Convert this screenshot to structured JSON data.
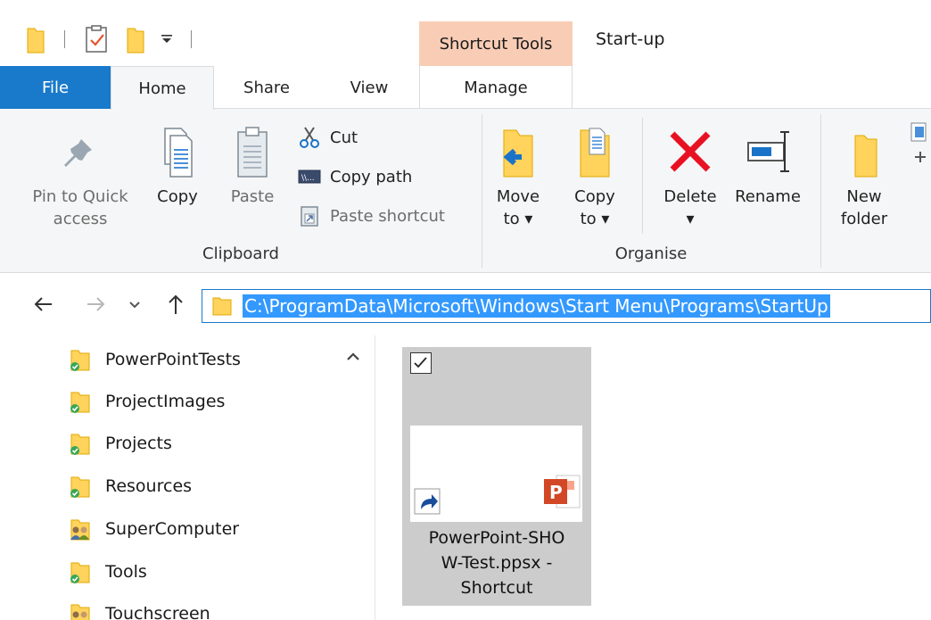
{
  "window": {
    "title": "Start-up",
    "contextual_group": "Shortcut Tools"
  },
  "tabs": {
    "file": "File",
    "home": "Home",
    "share": "Share",
    "view": "View",
    "manage": "Manage"
  },
  "ribbon": {
    "clipboard": {
      "group_label": "Clipboard",
      "pin_line1": "Pin to Quick",
      "pin_line2": "access",
      "copy": "Copy",
      "paste": "Paste",
      "cut": "Cut",
      "copy_path": "Copy path",
      "paste_shortcut": "Paste shortcut"
    },
    "organise": {
      "group_label": "Organise",
      "move_line1": "Move",
      "move_line2": "to ▾",
      "copy_line1": "Copy",
      "copy_line2": "to ▾",
      "delete_line1": "Delete",
      "delete_line2": "▾",
      "rename": "Rename"
    },
    "new": {
      "new_folder_line1": "New",
      "new_folder_line2": "folder"
    }
  },
  "address": {
    "path": "C:\\ProgramData\\Microsoft\\Windows\\Start Menu\\Programs\\StartUp"
  },
  "nav_tree": [
    {
      "label": "PowerPointTests",
      "icon": "folder-synced-icon"
    },
    {
      "label": "ProjectImages",
      "icon": "folder-synced-icon"
    },
    {
      "label": "Projects",
      "icon": "folder-synced-icon"
    },
    {
      "label": "Resources",
      "icon": "folder-synced-icon"
    },
    {
      "label": "SuperComputer",
      "icon": "shared-folder-icon"
    },
    {
      "label": "Tools",
      "icon": "folder-synced-icon"
    },
    {
      "label": "Touchscreen",
      "icon": "shared-folder-icon"
    }
  ],
  "files": [
    {
      "name_line1": "PowerPoint-SHO",
      "name_line2": "W-Test.ppsx -",
      "name_line3": "Shortcut",
      "selected": true,
      "icon": "powerpoint-shortcut-icon"
    }
  ],
  "colors": {
    "file_tab": "#1979ca",
    "contextual": "#f9cdb5",
    "selection": "#3399ff",
    "folder": "#ffd35c",
    "delete_red": "#e81123"
  }
}
